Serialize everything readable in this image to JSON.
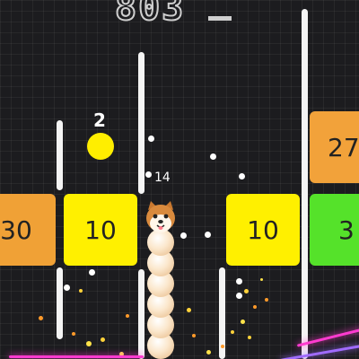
{
  "hud": {
    "score": "803"
  },
  "snake": {
    "length_label": "14"
  },
  "ball": {
    "value": "2"
  },
  "blocks": [
    {
      "value": "30",
      "color": "#f0a136"
    },
    {
      "value": "10",
      "color": "#fff000"
    },
    {
      "value": "10",
      "color": "#fff000"
    },
    {
      "value": "27",
      "color": "#f2a23a"
    },
    {
      "value": "3",
      "color": "#55e22a"
    }
  ],
  "colors": {
    "block_orange": "#f0a136",
    "block_yellow": "#fff000",
    "block_green": "#55e22a",
    "neon_pink": "#ff3bd0"
  }
}
